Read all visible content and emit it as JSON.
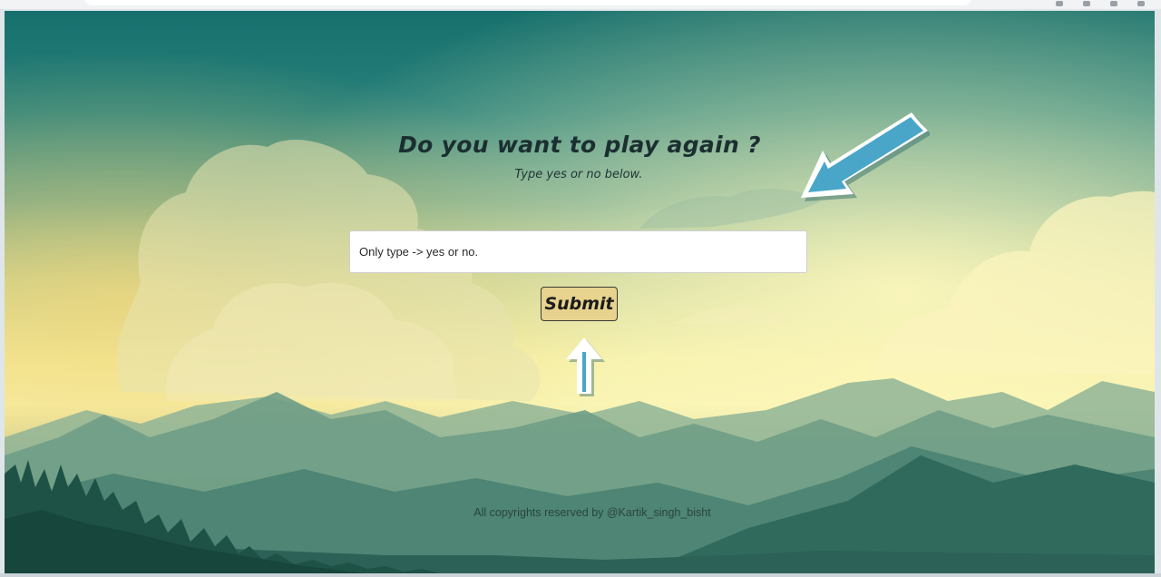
{
  "prompt": {
    "title": "Do you want to play again ?",
    "subtitle": "Type yes or no below."
  },
  "answer_field": {
    "placeholder": "Only type -> yes or no.",
    "value": ""
  },
  "submit_label": "Submit",
  "footer_text": "All copyrights reserved by @Kartik_singh_bisht",
  "colors": {
    "sky_top": "#17706d",
    "sky_glow": "#f6f2ae",
    "button_bg": "#e7d28e",
    "annotation_arrow": "#4aa6c9"
  },
  "icons": [
    "arrow-annotation-icon",
    "arrow-annotation-icon"
  ]
}
